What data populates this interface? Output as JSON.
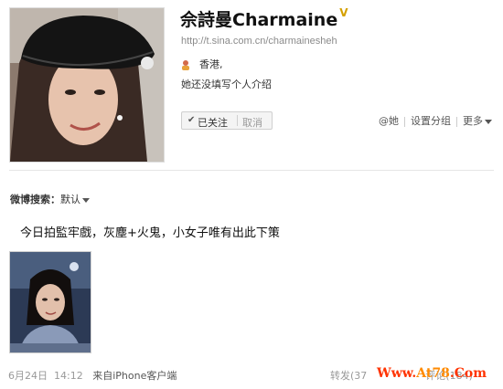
{
  "profile": {
    "name": "佘詩曼Charmaine",
    "verified_badge": "V",
    "url": "http://t.sina.com.cn/charmainesheh",
    "location": "香港,",
    "bio": "她还没填写个人介绍"
  },
  "follow": {
    "followed_label": "已关注",
    "separator": "|",
    "cancel_label": "取消"
  },
  "actions": {
    "at_label": "@她",
    "group_label": "设置分组",
    "more_label": "更多"
  },
  "search": {
    "label": "微博搜索：",
    "value": "默认"
  },
  "post": {
    "text": "今日拍監牢戲，灰塵+火鬼，小女子唯有出此下策",
    "date": "6月24日",
    "time": "14:12",
    "source": "来自iPhone客户端",
    "repost_label": "转发(37",
    "comment_label": "评论(184)"
  },
  "watermark": {
    "part1": "Www.",
    "part2": "At78",
    "part3": ".Com"
  },
  "colors": {
    "link": "#2b6ebd",
    "watermark_red": "#ff3300",
    "watermark_orange": "#ff8a00",
    "verified_gold": "#d4a000"
  }
}
